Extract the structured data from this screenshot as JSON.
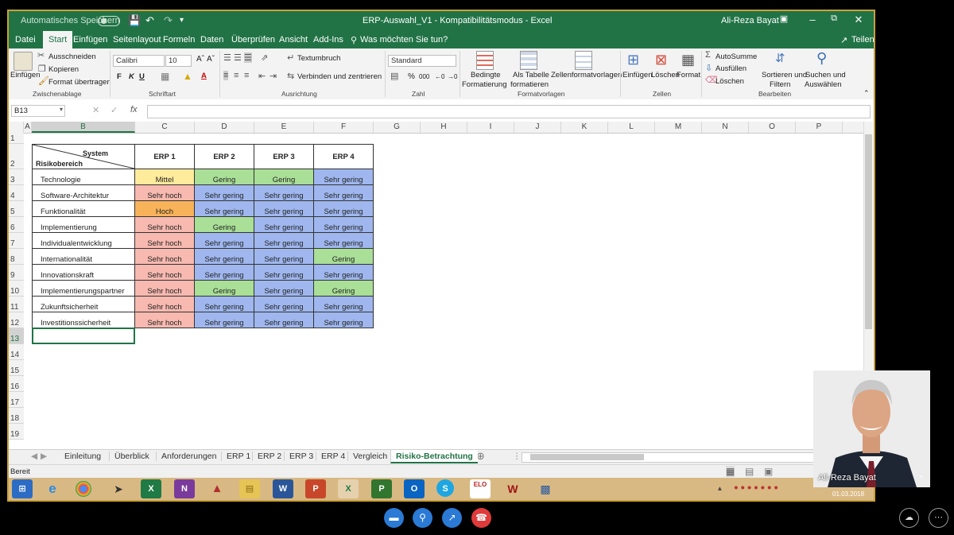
{
  "window": {
    "autosave_label": "Automatisches Speichern",
    "autosave_state": "Aus",
    "title": "ERP-Auswahl_V1  -  Kompatibilitätsmodus  -  Excel",
    "user": "Ali-Reza Bayat"
  },
  "ribbon_tabs": [
    "Datei",
    "Start",
    "Einfügen",
    "Seitenlayout",
    "Formeln",
    "Daten",
    "Überprüfen",
    "Ansicht",
    "Add-Ins"
  ],
  "tell_me": "Was möchten Sie tun?",
  "share": "Teilen",
  "ribbon": {
    "clipboard": {
      "paste": "Einfügen",
      "cut": "Ausschneiden",
      "copy": "Kopieren",
      "format_painter": "Format übertragen",
      "group": "Zwischenablage"
    },
    "font": {
      "name": "Calibri",
      "size": "10",
      "bold": "F",
      "italic": "K",
      "underline": "U",
      "group": "Schriftart"
    },
    "alignment": {
      "wrap": "Textumbruch",
      "merge": "Verbinden und zentrieren",
      "group": "Ausrichtung"
    },
    "number": {
      "format": "Standard",
      "percent": "%",
      "thousands": "000",
      "group": "Zahl"
    },
    "styles": {
      "conditional_1": "Bedingte",
      "conditional_2": "Formatierung",
      "as_table_1": "Als Tabelle",
      "as_table_2": "formatieren",
      "cell_styles": "Zellenformatvorlagen",
      "group": "Formatvorlagen"
    },
    "cells": {
      "insert": "Einfügen",
      "delete": "Löschen",
      "format": "Format",
      "group": "Zellen"
    },
    "editing": {
      "autosum": "AutoSumme",
      "fill": "Ausfüllen",
      "clear": "Löschen",
      "sort_1": "Sortieren und",
      "sort_2": "Filtern",
      "find_1": "Suchen und",
      "find_2": "Auswählen",
      "group": "Bearbeiten"
    }
  },
  "formula_bar": {
    "name_box": "B13",
    "fx": "fx",
    "content": ""
  },
  "columns": [
    "A",
    "B",
    "C",
    "D",
    "E",
    "F",
    "G",
    "H",
    "I",
    "J",
    "K",
    "L",
    "M",
    "N",
    "O",
    "P"
  ],
  "rows": [
    "1",
    "2",
    "3",
    "4",
    "5",
    "6",
    "7",
    "8",
    "9",
    "10",
    "11",
    "12",
    "13",
    "14",
    "15",
    "16",
    "17",
    "18",
    "19"
  ],
  "table": {
    "corner_top": "System",
    "corner_bottom": "Risikobereich",
    "headers": [
      "ERP 1",
      "ERP 2",
      "ERP 3",
      "ERP 4"
    ],
    "rows": [
      {
        "label": "Technologie",
        "values": [
          "Mittel",
          "Gering",
          "Gering",
          "Sehr gering"
        ]
      },
      {
        "label": "Software-Architektur",
        "values": [
          "Sehr hoch",
          "Sehr gering",
          "Sehr gering",
          "Sehr gering"
        ]
      },
      {
        "label": "Funktionalität",
        "values": [
          "Hoch",
          "Sehr gering",
          "Sehr gering",
          "Sehr gering"
        ]
      },
      {
        "label": "Implementierung",
        "values": [
          "Sehr hoch",
          "Gering",
          "Sehr gering",
          "Sehr gering"
        ]
      },
      {
        "label": "Individualentwicklung",
        "values": [
          "Sehr hoch",
          "Sehr gering",
          "Sehr gering",
          "Sehr gering"
        ]
      },
      {
        "label": "Internationalität",
        "values": [
          "Sehr hoch",
          "Sehr gering",
          "Sehr gering",
          "Gering"
        ]
      },
      {
        "label": "Innovationskraft",
        "values": [
          "Sehr hoch",
          "Sehr gering",
          "Sehr gering",
          "Sehr gering"
        ]
      },
      {
        "label": "Implementierungspartner",
        "values": [
          "Sehr hoch",
          "Gering",
          "Sehr gering",
          "Gering"
        ]
      },
      {
        "label": "Zukunftsicherheit",
        "values": [
          "Sehr hoch",
          "Sehr gering",
          "Sehr gering",
          "Sehr gering"
        ]
      },
      {
        "label": "Investitionssicherheit",
        "values": [
          "Sehr hoch",
          "Sehr gering",
          "Sehr gering",
          "Sehr gering"
        ]
      }
    ]
  },
  "risk_colors": {
    "Mittel": "#ffeb9c",
    "Hoch": "#f8b35a",
    "Sehr hoch": "#f7b9b0",
    "Gering": "#a9df97",
    "Sehr gering": "#9fb7ee"
  },
  "sheet_tabs": [
    "Einleitung",
    "Überblick",
    "Anforderungen",
    "ERP 1",
    "ERP 2",
    "ERP 3",
    "ERP 4",
    "Vergleich",
    "Risiko-Betrachtung"
  ],
  "active_sheet": "Risiko-Betrachtung",
  "status": "Bereit",
  "taskbar": {
    "apps": [
      "Start",
      "Internet Explorer",
      "Chrome",
      "Terminal",
      "Excel",
      "OneNote",
      "Access",
      "Explorer",
      "Word",
      "PowerPoint",
      "Excel",
      "Project",
      "Outlook",
      "Skype",
      "ELO",
      "Adobe",
      "Remote"
    ],
    "date": "01.03.2018"
  },
  "video": {
    "name": "Ali-Reza Bayat"
  },
  "accent": "#217346"
}
